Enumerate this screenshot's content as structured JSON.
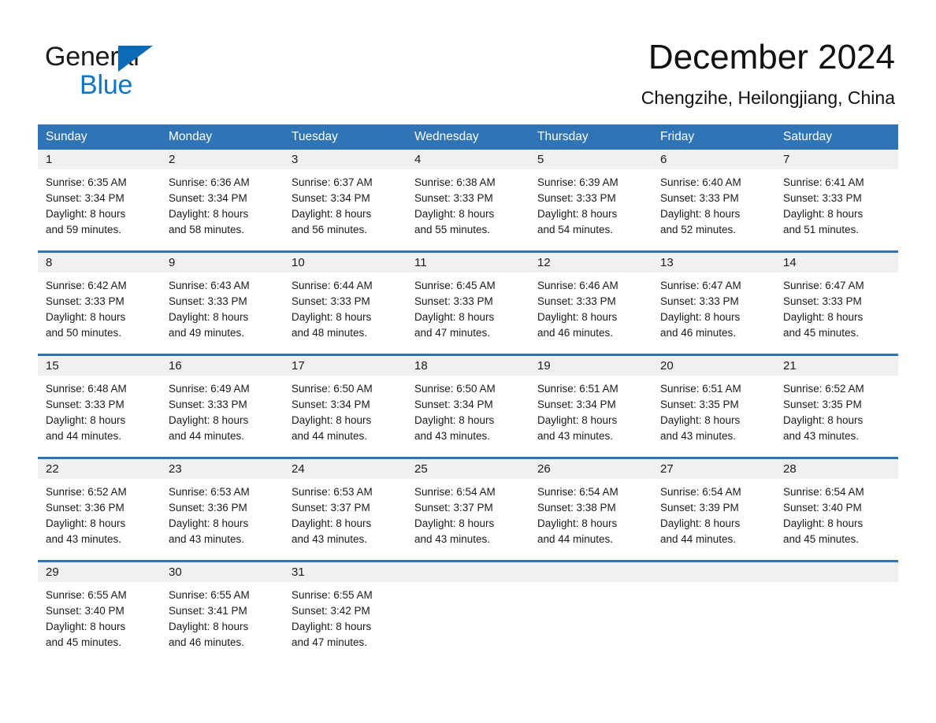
{
  "brand": {
    "name_top": "General",
    "name_bottom": "Blue",
    "accent_color": "#1275c4",
    "triangle_color": "#0d6ab5"
  },
  "header": {
    "title": "December 2024",
    "subtitle": "Chengzihe, Heilongjiang, China"
  },
  "theme": {
    "header_blue": "#2f74b5",
    "daynum_band_gray": "#f0f0f0",
    "text_color": "#1a1a1a"
  },
  "weekdays": [
    "Sunday",
    "Monday",
    "Tuesday",
    "Wednesday",
    "Thursday",
    "Friday",
    "Saturday"
  ],
  "weeks": [
    {
      "days": [
        {
          "num": "1",
          "sunrise": "Sunrise: 6:35 AM",
          "sunset": "Sunset: 3:34 PM",
          "daylight1": "Daylight: 8 hours",
          "daylight2": "and 59 minutes."
        },
        {
          "num": "2",
          "sunrise": "Sunrise: 6:36 AM",
          "sunset": "Sunset: 3:34 PM",
          "daylight1": "Daylight: 8 hours",
          "daylight2": "and 58 minutes."
        },
        {
          "num": "3",
          "sunrise": "Sunrise: 6:37 AM",
          "sunset": "Sunset: 3:34 PM",
          "daylight1": "Daylight: 8 hours",
          "daylight2": "and 56 minutes."
        },
        {
          "num": "4",
          "sunrise": "Sunrise: 6:38 AM",
          "sunset": "Sunset: 3:33 PM",
          "daylight1": "Daylight: 8 hours",
          "daylight2": "and 55 minutes."
        },
        {
          "num": "5",
          "sunrise": "Sunrise: 6:39 AM",
          "sunset": "Sunset: 3:33 PM",
          "daylight1": "Daylight: 8 hours",
          "daylight2": "and 54 minutes."
        },
        {
          "num": "6",
          "sunrise": "Sunrise: 6:40 AM",
          "sunset": "Sunset: 3:33 PM",
          "daylight1": "Daylight: 8 hours",
          "daylight2": "and 52 minutes."
        },
        {
          "num": "7",
          "sunrise": "Sunrise: 6:41 AM",
          "sunset": "Sunset: 3:33 PM",
          "daylight1": "Daylight: 8 hours",
          "daylight2": "and 51 minutes."
        }
      ]
    },
    {
      "days": [
        {
          "num": "8",
          "sunrise": "Sunrise: 6:42 AM",
          "sunset": "Sunset: 3:33 PM",
          "daylight1": "Daylight: 8 hours",
          "daylight2": "and 50 minutes."
        },
        {
          "num": "9",
          "sunrise": "Sunrise: 6:43 AM",
          "sunset": "Sunset: 3:33 PM",
          "daylight1": "Daylight: 8 hours",
          "daylight2": "and 49 minutes."
        },
        {
          "num": "10",
          "sunrise": "Sunrise: 6:44 AM",
          "sunset": "Sunset: 3:33 PM",
          "daylight1": "Daylight: 8 hours",
          "daylight2": "and 48 minutes."
        },
        {
          "num": "11",
          "sunrise": "Sunrise: 6:45 AM",
          "sunset": "Sunset: 3:33 PM",
          "daylight1": "Daylight: 8 hours",
          "daylight2": "and 47 minutes."
        },
        {
          "num": "12",
          "sunrise": "Sunrise: 6:46 AM",
          "sunset": "Sunset: 3:33 PM",
          "daylight1": "Daylight: 8 hours",
          "daylight2": "and 46 minutes."
        },
        {
          "num": "13",
          "sunrise": "Sunrise: 6:47 AM",
          "sunset": "Sunset: 3:33 PM",
          "daylight1": "Daylight: 8 hours",
          "daylight2": "and 46 minutes."
        },
        {
          "num": "14",
          "sunrise": "Sunrise: 6:47 AM",
          "sunset": "Sunset: 3:33 PM",
          "daylight1": "Daylight: 8 hours",
          "daylight2": "and 45 minutes."
        }
      ]
    },
    {
      "days": [
        {
          "num": "15",
          "sunrise": "Sunrise: 6:48 AM",
          "sunset": "Sunset: 3:33 PM",
          "daylight1": "Daylight: 8 hours",
          "daylight2": "and 44 minutes."
        },
        {
          "num": "16",
          "sunrise": "Sunrise: 6:49 AM",
          "sunset": "Sunset: 3:33 PM",
          "daylight1": "Daylight: 8 hours",
          "daylight2": "and 44 minutes."
        },
        {
          "num": "17",
          "sunrise": "Sunrise: 6:50 AM",
          "sunset": "Sunset: 3:34 PM",
          "daylight1": "Daylight: 8 hours",
          "daylight2": "and 44 minutes."
        },
        {
          "num": "18",
          "sunrise": "Sunrise: 6:50 AM",
          "sunset": "Sunset: 3:34 PM",
          "daylight1": "Daylight: 8 hours",
          "daylight2": "and 43 minutes."
        },
        {
          "num": "19",
          "sunrise": "Sunrise: 6:51 AM",
          "sunset": "Sunset: 3:34 PM",
          "daylight1": "Daylight: 8 hours",
          "daylight2": "and 43 minutes."
        },
        {
          "num": "20",
          "sunrise": "Sunrise: 6:51 AM",
          "sunset": "Sunset: 3:35 PM",
          "daylight1": "Daylight: 8 hours",
          "daylight2": "and 43 minutes."
        },
        {
          "num": "21",
          "sunrise": "Sunrise: 6:52 AM",
          "sunset": "Sunset: 3:35 PM",
          "daylight1": "Daylight: 8 hours",
          "daylight2": "and 43 minutes."
        }
      ]
    },
    {
      "days": [
        {
          "num": "22",
          "sunrise": "Sunrise: 6:52 AM",
          "sunset": "Sunset: 3:36 PM",
          "daylight1": "Daylight: 8 hours",
          "daylight2": "and 43 minutes."
        },
        {
          "num": "23",
          "sunrise": "Sunrise: 6:53 AM",
          "sunset": "Sunset: 3:36 PM",
          "daylight1": "Daylight: 8 hours",
          "daylight2": "and 43 minutes."
        },
        {
          "num": "24",
          "sunrise": "Sunrise: 6:53 AM",
          "sunset": "Sunset: 3:37 PM",
          "daylight1": "Daylight: 8 hours",
          "daylight2": "and 43 minutes."
        },
        {
          "num": "25",
          "sunrise": "Sunrise: 6:54 AM",
          "sunset": "Sunset: 3:37 PM",
          "daylight1": "Daylight: 8 hours",
          "daylight2": "and 43 minutes."
        },
        {
          "num": "26",
          "sunrise": "Sunrise: 6:54 AM",
          "sunset": "Sunset: 3:38 PM",
          "daylight1": "Daylight: 8 hours",
          "daylight2": "and 44 minutes."
        },
        {
          "num": "27",
          "sunrise": "Sunrise: 6:54 AM",
          "sunset": "Sunset: 3:39 PM",
          "daylight1": "Daylight: 8 hours",
          "daylight2": "and 44 minutes."
        },
        {
          "num": "28",
          "sunrise": "Sunrise: 6:54 AM",
          "sunset": "Sunset: 3:40 PM",
          "daylight1": "Daylight: 8 hours",
          "daylight2": "and 45 minutes."
        }
      ]
    },
    {
      "days": [
        {
          "num": "29",
          "sunrise": "Sunrise: 6:55 AM",
          "sunset": "Sunset: 3:40 PM",
          "daylight1": "Daylight: 8 hours",
          "daylight2": "and 45 minutes."
        },
        {
          "num": "30",
          "sunrise": "Sunrise: 6:55 AM",
          "sunset": "Sunset: 3:41 PM",
          "daylight1": "Daylight: 8 hours",
          "daylight2": "and 46 minutes."
        },
        {
          "num": "31",
          "sunrise": "Sunrise: 6:55 AM",
          "sunset": "Sunset: 3:42 PM",
          "daylight1": "Daylight: 8 hours",
          "daylight2": "and 47 minutes."
        },
        {
          "num": "",
          "sunrise": "",
          "sunset": "",
          "daylight1": "",
          "daylight2": ""
        },
        {
          "num": "",
          "sunrise": "",
          "sunset": "",
          "daylight1": "",
          "daylight2": ""
        },
        {
          "num": "",
          "sunrise": "",
          "sunset": "",
          "daylight1": "",
          "daylight2": ""
        },
        {
          "num": "",
          "sunrise": "",
          "sunset": "",
          "daylight1": "",
          "daylight2": ""
        }
      ]
    }
  ]
}
